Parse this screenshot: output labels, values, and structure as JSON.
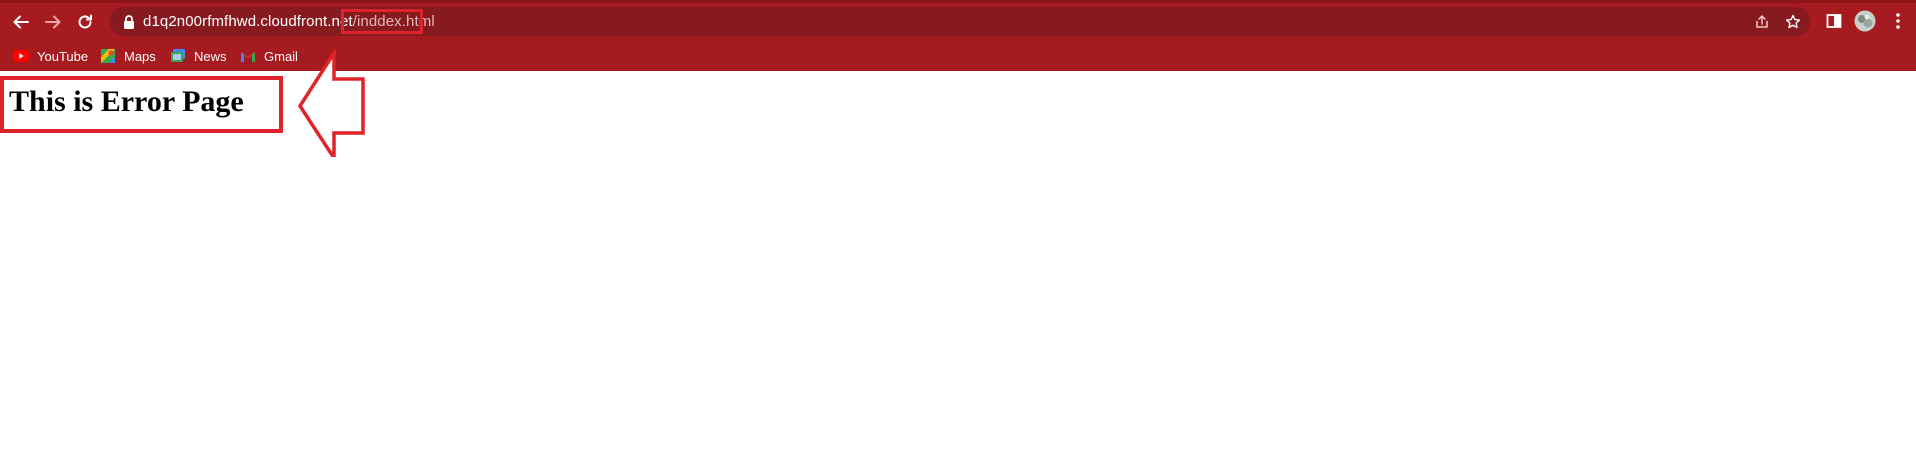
{
  "browser": {
    "url_host": "d1q2n00rfmfhwd.cloudfront.net",
    "url_path": "/inddex.html",
    "theme_color": "#a61b1f",
    "omnibox_color": "#861a1e"
  },
  "bookmarks": [
    {
      "label": "YouTube",
      "icon": "youtube-icon"
    },
    {
      "label": "Maps",
      "icon": "maps-icon"
    },
    {
      "label": "News",
      "icon": "news-icon"
    },
    {
      "label": "Gmail",
      "icon": "gmail-icon"
    }
  ],
  "page": {
    "heading": "This is Error Page"
  },
  "annotations": {
    "highlight_color": "#e0232a"
  }
}
